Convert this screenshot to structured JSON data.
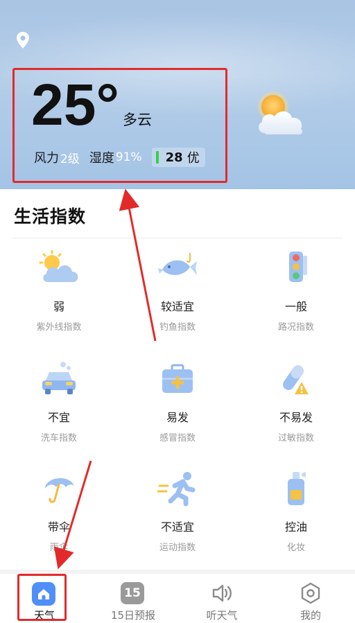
{
  "current": {
    "temperature": "25°",
    "condition": "多云",
    "wind_label": "风力",
    "wind_value": "2级",
    "humidity_label": "湿度",
    "humidity_value": "91%",
    "aqi_value": "28",
    "aqi_level": "优"
  },
  "life": {
    "title": "生活指数",
    "items": [
      {
        "value": "弱",
        "name": "紫外线指数",
        "icon": "sun-cloud-icon"
      },
      {
        "value": "较适宜",
        "name": "钓鱼指数",
        "icon": "fish-icon"
      },
      {
        "value": "一般",
        "name": "路况指数",
        "icon": "traffic-light-icon"
      },
      {
        "value": "不宜",
        "name": "洗车指数",
        "icon": "car-wash-icon"
      },
      {
        "value": "易发",
        "name": "感冒指数",
        "icon": "medical-kit-icon"
      },
      {
        "value": "不易发",
        "name": "过敏指数",
        "icon": "allergy-pill-icon"
      },
      {
        "value": "带伞",
        "name": "雨伞",
        "icon": "umbrella-icon"
      },
      {
        "value": "不适宜",
        "name": "运动指数",
        "icon": "running-icon"
      },
      {
        "value": "控油",
        "name": "化妆",
        "icon": "makeup-bottle-icon"
      }
    ]
  },
  "nav": {
    "items": [
      {
        "label": "天气",
        "icon": "home-icon",
        "active": true
      },
      {
        "label": "15日预报",
        "icon": "calendar-15-icon",
        "badge": "15"
      },
      {
        "label": "听天气",
        "icon": "speaker-icon"
      },
      {
        "label": "我的",
        "icon": "settings-hexagon-icon"
      }
    ]
  },
  "colors": {
    "accent_blue": "#4f8ff7",
    "highlight_red": "#e32a2a",
    "aqi_good": "#33d14b"
  }
}
